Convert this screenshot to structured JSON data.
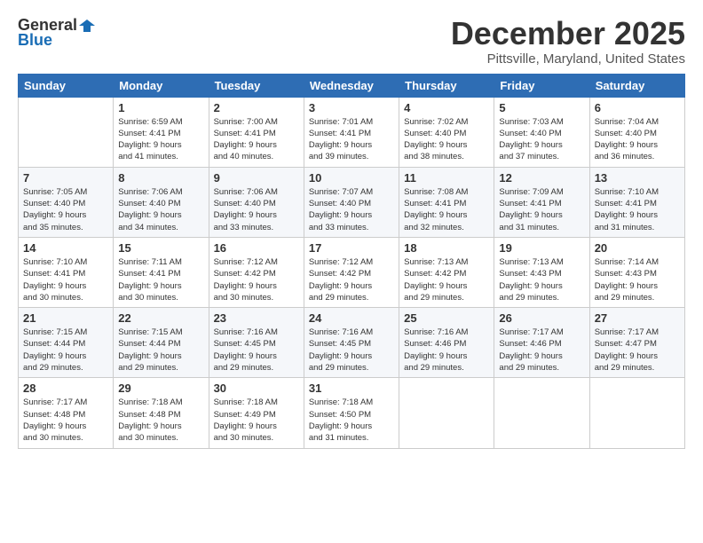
{
  "header": {
    "logo_general": "General",
    "logo_blue": "Blue",
    "month": "December 2025",
    "location": "Pittsville, Maryland, United States"
  },
  "weekdays": [
    "Sunday",
    "Monday",
    "Tuesday",
    "Wednesday",
    "Thursday",
    "Friday",
    "Saturday"
  ],
  "weeks": [
    [
      {
        "day": "",
        "info": ""
      },
      {
        "day": "1",
        "info": "Sunrise: 6:59 AM\nSunset: 4:41 PM\nDaylight: 9 hours\nand 41 minutes."
      },
      {
        "day": "2",
        "info": "Sunrise: 7:00 AM\nSunset: 4:41 PM\nDaylight: 9 hours\nand 40 minutes."
      },
      {
        "day": "3",
        "info": "Sunrise: 7:01 AM\nSunset: 4:41 PM\nDaylight: 9 hours\nand 39 minutes."
      },
      {
        "day": "4",
        "info": "Sunrise: 7:02 AM\nSunset: 4:40 PM\nDaylight: 9 hours\nand 38 minutes."
      },
      {
        "day": "5",
        "info": "Sunrise: 7:03 AM\nSunset: 4:40 PM\nDaylight: 9 hours\nand 37 minutes."
      },
      {
        "day": "6",
        "info": "Sunrise: 7:04 AM\nSunset: 4:40 PM\nDaylight: 9 hours\nand 36 minutes."
      }
    ],
    [
      {
        "day": "7",
        "info": "Sunrise: 7:05 AM\nSunset: 4:40 PM\nDaylight: 9 hours\nand 35 minutes."
      },
      {
        "day": "8",
        "info": "Sunrise: 7:06 AM\nSunset: 4:40 PM\nDaylight: 9 hours\nand 34 minutes."
      },
      {
        "day": "9",
        "info": "Sunrise: 7:06 AM\nSunset: 4:40 PM\nDaylight: 9 hours\nand 33 minutes."
      },
      {
        "day": "10",
        "info": "Sunrise: 7:07 AM\nSunset: 4:40 PM\nDaylight: 9 hours\nand 33 minutes."
      },
      {
        "day": "11",
        "info": "Sunrise: 7:08 AM\nSunset: 4:41 PM\nDaylight: 9 hours\nand 32 minutes."
      },
      {
        "day": "12",
        "info": "Sunrise: 7:09 AM\nSunset: 4:41 PM\nDaylight: 9 hours\nand 31 minutes."
      },
      {
        "day": "13",
        "info": "Sunrise: 7:10 AM\nSunset: 4:41 PM\nDaylight: 9 hours\nand 31 minutes."
      }
    ],
    [
      {
        "day": "14",
        "info": "Sunrise: 7:10 AM\nSunset: 4:41 PM\nDaylight: 9 hours\nand 30 minutes."
      },
      {
        "day": "15",
        "info": "Sunrise: 7:11 AM\nSunset: 4:41 PM\nDaylight: 9 hours\nand 30 minutes."
      },
      {
        "day": "16",
        "info": "Sunrise: 7:12 AM\nSunset: 4:42 PM\nDaylight: 9 hours\nand 30 minutes."
      },
      {
        "day": "17",
        "info": "Sunrise: 7:12 AM\nSunset: 4:42 PM\nDaylight: 9 hours\nand 29 minutes."
      },
      {
        "day": "18",
        "info": "Sunrise: 7:13 AM\nSunset: 4:42 PM\nDaylight: 9 hours\nand 29 minutes."
      },
      {
        "day": "19",
        "info": "Sunrise: 7:13 AM\nSunset: 4:43 PM\nDaylight: 9 hours\nand 29 minutes."
      },
      {
        "day": "20",
        "info": "Sunrise: 7:14 AM\nSunset: 4:43 PM\nDaylight: 9 hours\nand 29 minutes."
      }
    ],
    [
      {
        "day": "21",
        "info": "Sunrise: 7:15 AM\nSunset: 4:44 PM\nDaylight: 9 hours\nand 29 minutes."
      },
      {
        "day": "22",
        "info": "Sunrise: 7:15 AM\nSunset: 4:44 PM\nDaylight: 9 hours\nand 29 minutes."
      },
      {
        "day": "23",
        "info": "Sunrise: 7:16 AM\nSunset: 4:45 PM\nDaylight: 9 hours\nand 29 minutes."
      },
      {
        "day": "24",
        "info": "Sunrise: 7:16 AM\nSunset: 4:45 PM\nDaylight: 9 hours\nand 29 minutes."
      },
      {
        "day": "25",
        "info": "Sunrise: 7:16 AM\nSunset: 4:46 PM\nDaylight: 9 hours\nand 29 minutes."
      },
      {
        "day": "26",
        "info": "Sunrise: 7:17 AM\nSunset: 4:46 PM\nDaylight: 9 hours\nand 29 minutes."
      },
      {
        "day": "27",
        "info": "Sunrise: 7:17 AM\nSunset: 4:47 PM\nDaylight: 9 hours\nand 29 minutes."
      }
    ],
    [
      {
        "day": "28",
        "info": "Sunrise: 7:17 AM\nSunset: 4:48 PM\nDaylight: 9 hours\nand 30 minutes."
      },
      {
        "day": "29",
        "info": "Sunrise: 7:18 AM\nSunset: 4:48 PM\nDaylight: 9 hours\nand 30 minutes."
      },
      {
        "day": "30",
        "info": "Sunrise: 7:18 AM\nSunset: 4:49 PM\nDaylight: 9 hours\nand 30 minutes."
      },
      {
        "day": "31",
        "info": "Sunrise: 7:18 AM\nSunset: 4:50 PM\nDaylight: 9 hours\nand 31 minutes."
      },
      {
        "day": "",
        "info": ""
      },
      {
        "day": "",
        "info": ""
      },
      {
        "day": "",
        "info": ""
      }
    ]
  ]
}
